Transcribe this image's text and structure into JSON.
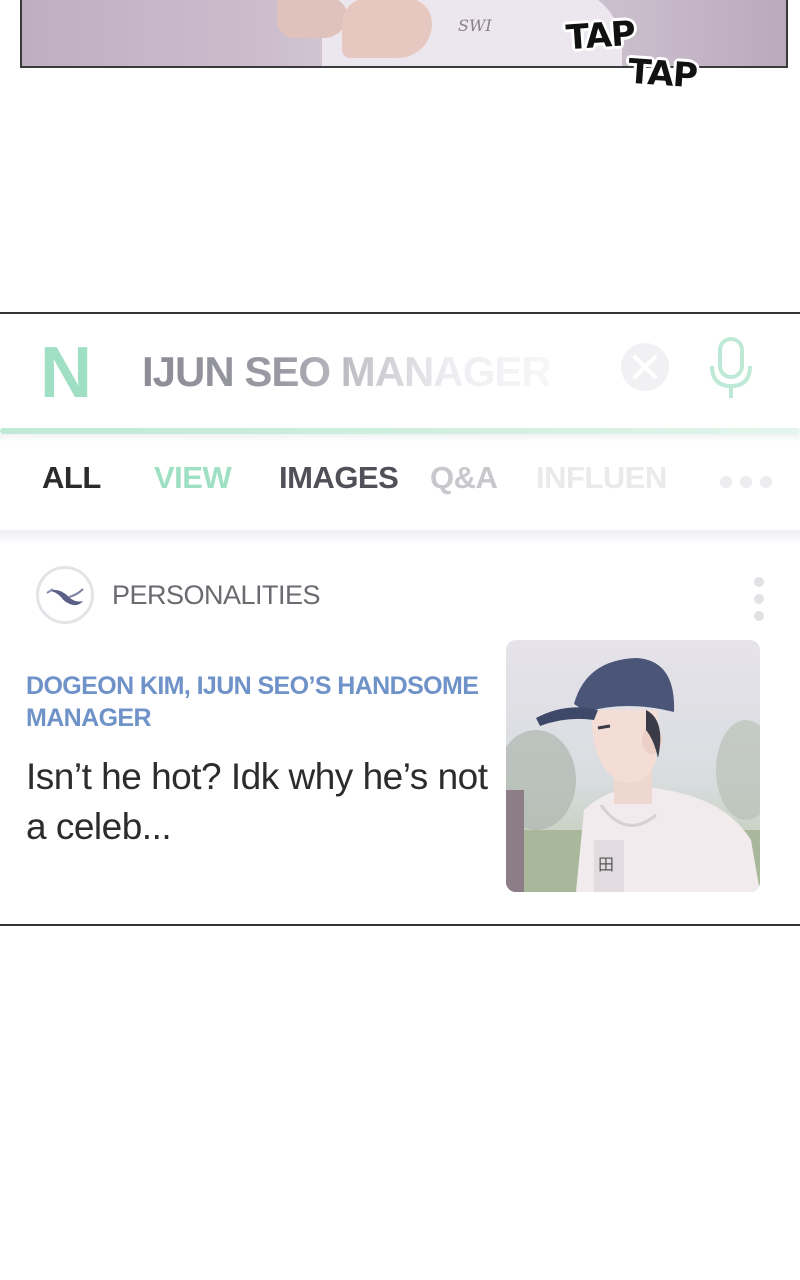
{
  "top_panel": {
    "shirt_print": "SWI",
    "sfx": [
      "TAP",
      "TAP"
    ]
  },
  "search": {
    "logo": "N",
    "query": "IJUN SEO MANAGER",
    "clear_icon": "clear-x-icon",
    "mic_icon": "microphone-icon",
    "accent_color": "#9fe0c4"
  },
  "tabs": [
    {
      "label": "ALL",
      "active": true
    },
    {
      "label": "VIEW"
    },
    {
      "label": "IMAGES"
    },
    {
      "label": "Q&A"
    },
    {
      "label": "INFLUEN"
    }
  ],
  "more_icon": "more-dots-icon",
  "result": {
    "source_icon": "whale-icon",
    "source": "PERSONALITIES",
    "title": "DOGEON KIM, IJUN SEO’S HANDSOME MANAGER",
    "snippet": "Isn’t he hot? Idk why he’s not a celeb...",
    "thumbnail": "man-in-cap-photo",
    "title_color": "#6f93c8"
  }
}
